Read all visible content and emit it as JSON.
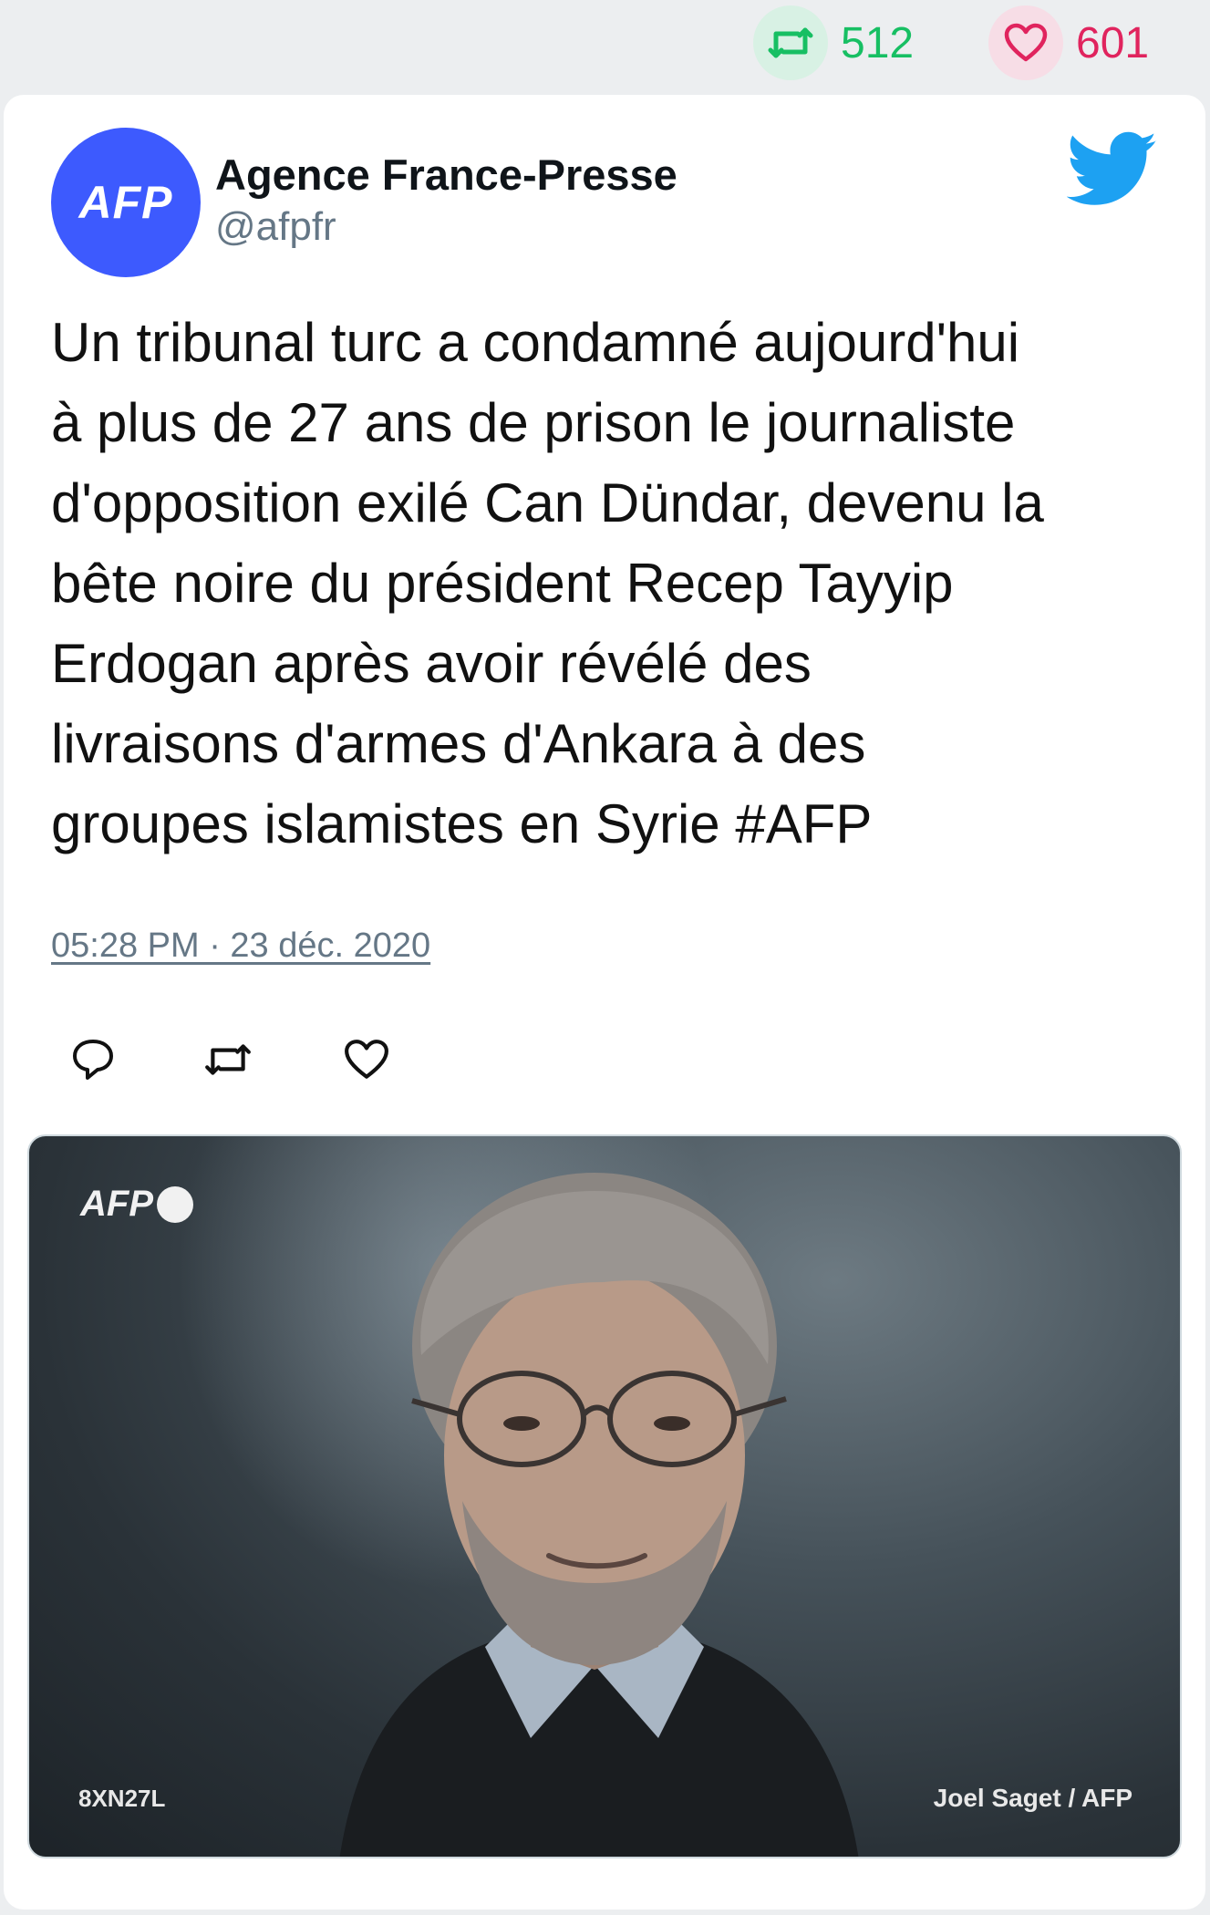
{
  "stats": {
    "retweets": "512",
    "likes": "601"
  },
  "author": {
    "avatar_text": "AFP",
    "name": "Agence France-Presse",
    "handle": "@afpfr"
  },
  "tweet": {
    "text": "Un tribunal turc a condamné aujourd'hui\nà plus de 27 ans de prison le journaliste\nd'opposition exilé Can Dündar, devenu la\nbête noire du président Recep Tayyip\nErdogan après avoir révélé des\nlivraisons d'armes d'Ankara à des\ngroupes islamistes en Syrie #AFP",
    "timestamp": "05:28 PM · 23 déc. 2020"
  },
  "media": {
    "logo_text": "AFP",
    "photo_id": "8XN27L",
    "credit": "Joel Saget / AFP"
  },
  "icons": {
    "retweet": "retweet-icon",
    "like": "heart-icon",
    "reply": "reply-icon",
    "brand": "twitter-bird-icon"
  },
  "colors": {
    "retweet": "#17bf63",
    "like": "#e0245e",
    "twitter_blue": "#1da1f2",
    "avatar_bg": "#3d5afe"
  }
}
